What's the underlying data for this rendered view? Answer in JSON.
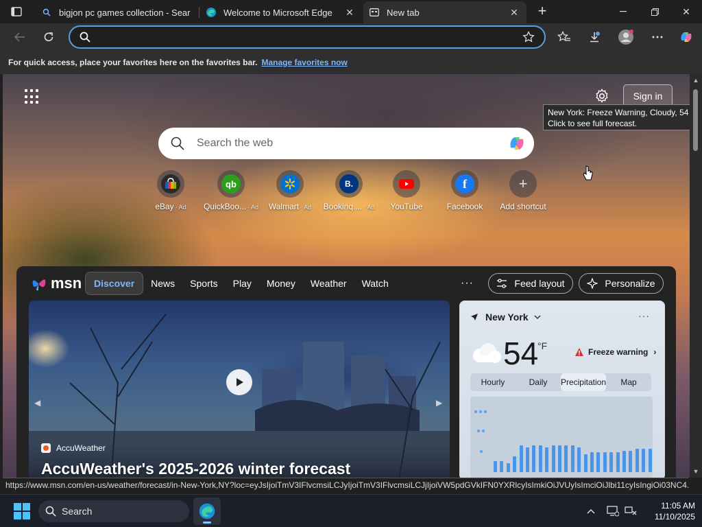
{
  "tabs": [
    {
      "title": "bigjon pc games collection - Sear",
      "icon": "search-icon",
      "active": false
    },
    {
      "title": "Welcome to Microsoft Edge",
      "icon": "edge-icon",
      "active": false
    },
    {
      "title": "New tab",
      "icon": "newtab-icon",
      "active": true
    }
  ],
  "address_bar": {
    "value": "",
    "placeholder": ""
  },
  "favorites_bar": {
    "message": "For quick access, place your favorites here on the favorites bar.",
    "link": "Manage favorites now"
  },
  "newtab": {
    "signin_label": "Sign in",
    "tooltip_line1": "New York: Freeze Warning, Cloudy, 54 °F",
    "tooltip_line2": "Click to see full forecast.",
    "search_placeholder": "Search the web",
    "shortcuts": [
      {
        "label": "eBay",
        "ad": "· Ad",
        "icon": "ebay-icon",
        "color": "#2b2b2b"
      },
      {
        "label": "QuickBoo...",
        "ad": "· Ad",
        "icon": "quickbooks-icon",
        "color": "#2ca01c"
      },
      {
        "label": "Walmart",
        "ad": "· Ad",
        "icon": "walmart-icon",
        "color": "#0071ce"
      },
      {
        "label": "Bookinq....",
        "ad": "· Ad",
        "icon": "booking-icon",
        "color": "#003580"
      },
      {
        "label": "YouTube",
        "ad": "",
        "icon": "youtube-icon",
        "color": "#ff0000"
      },
      {
        "label": "Facebook",
        "ad": "",
        "icon": "facebook-icon",
        "color": "#1877f2"
      },
      {
        "label": "Add shortcut",
        "ad": "",
        "icon": "plus-icon",
        "color": "#5a5a5a"
      }
    ]
  },
  "msn": {
    "logo_text": "msn",
    "nav": [
      "Discover",
      "News",
      "Sports",
      "Play",
      "Money",
      "Weather",
      "Watch"
    ],
    "more": "···",
    "feed_layout_label": "Feed layout",
    "personalize_label": "Personalize",
    "hero": {
      "source": "AccuWeather",
      "title": "AccuWeather's 2025-2026 winter forecast"
    },
    "weather": {
      "location": "New York",
      "temperature": "54",
      "unit": "°F",
      "alert": "Freeze warning",
      "tabs": [
        "Hourly",
        "Daily",
        "Precipitation",
        "Map"
      ],
      "active_tab": "Precipitation",
      "precip_bars": [
        0.12,
        0.12,
        0.1,
        0.18,
        0.3,
        0.28,
        0.3,
        0.3,
        0.28,
        0.3,
        0.3,
        0.3,
        0.3,
        0.28,
        0.2,
        0.22,
        0.22,
        0.22,
        0.22,
        0.22,
        0.24,
        0.24,
        0.26,
        0.26,
        0.26
      ]
    }
  },
  "status_url": "https://www.msn.com/en-us/weather/forecast/in-New-York,NY?loc=eyJsIjoiTmV3IFlvcmsiLCJyIjoiTmV3IFlvcmsiLCJjIjoiVW5pdGVkIFN0YXRlcyIsImkiOiJVUyIsImciOiJlbi11cyIsIngiOi03NC4...",
  "taskbar": {
    "search_label": "Search",
    "time": "11:05 AM",
    "date": "11/10/2025"
  },
  "colors": {
    "accent": "#5aa0e6",
    "start_blue": "#4cc2ff"
  }
}
